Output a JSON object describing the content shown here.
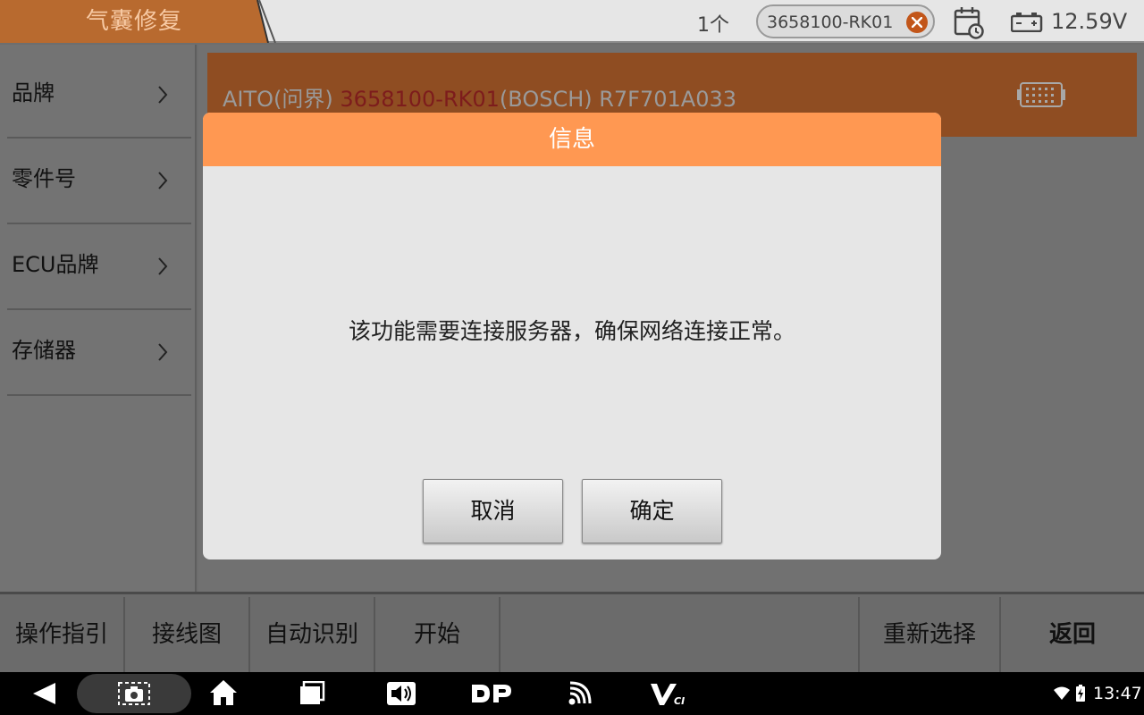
{
  "header": {
    "title": "气囊修复",
    "count": "1个",
    "search_chip": {
      "label": "3658100-RK01",
      "clear_icon": "close-icon"
    },
    "history_icon": "calendar-clock-icon",
    "battery_icon": "battery-icon",
    "voltage": "12.59V"
  },
  "sidebar": {
    "items": [
      {
        "label": "品牌"
      },
      {
        "label": "零件号"
      },
      {
        "label": "ECU品牌"
      },
      {
        "label": "存储器"
      }
    ]
  },
  "result": {
    "brand": "AITO(问界) ",
    "part": "3658100-RK01",
    "rest": "(BOSCH) R7F701A033",
    "icon": "ecu-chip-icon"
  },
  "dialog": {
    "title": "信息",
    "message": "该功能需要连接服务器，确保网络连接正常。",
    "cancel_label": "取消",
    "ok_label": "确定"
  },
  "toolbar": {
    "guide": "操作指引",
    "wiring": "接线图",
    "auto_detect": "自动识别",
    "start": "开始",
    "reselect": "重新选择",
    "back": "返回"
  },
  "system_bar": {
    "time": "13:47",
    "icons": [
      "back-icon",
      "screenshot-icon",
      "home-icon",
      "recents-icon",
      "volume-icon",
      "dp-icon",
      "vci-signal-icon",
      "vci-icon",
      "wifi-icon",
      "battery-charging-icon"
    ]
  },
  "colors": {
    "accent": "#ff9852",
    "title_tab": "#b86a2f",
    "highlight_text": "#7d1c1c"
  }
}
